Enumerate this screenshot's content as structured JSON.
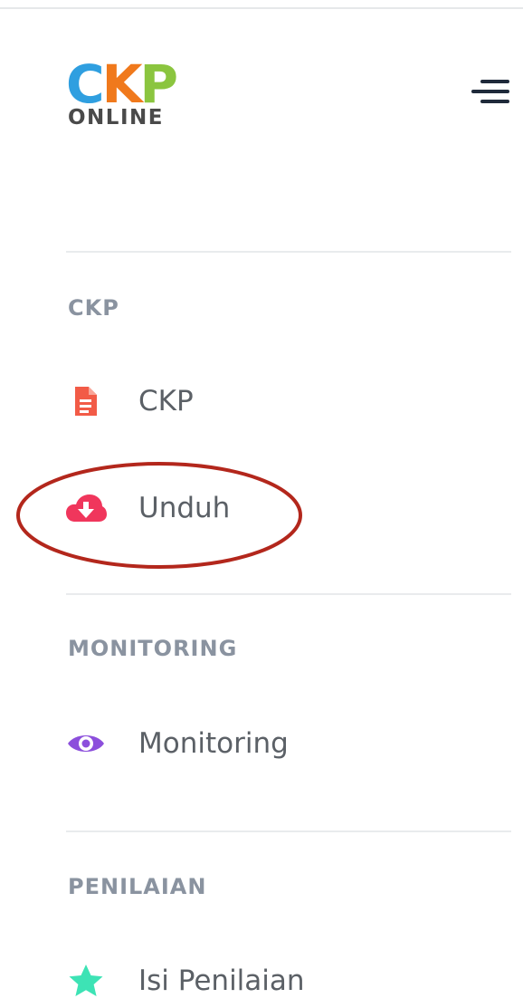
{
  "logo": {
    "letters": [
      "C",
      "K",
      "P"
    ],
    "subtitle": "ONLINE",
    "colors": {
      "c": "#2f9fe0",
      "k": "#f0791c",
      "p": "#8bc53f"
    }
  },
  "menu_toggle_icon": "hamburger-icon",
  "sections": [
    {
      "title": "CKP",
      "items": [
        {
          "label": "CKP",
          "icon": "file-icon",
          "icon_color": "#f25b47"
        },
        {
          "label": "Unduh",
          "icon": "cloud-download-icon",
          "icon_color": "#f0365c"
        }
      ]
    },
    {
      "title": "MONITORING",
      "items": [
        {
          "label": "Monitoring",
          "icon": "eye-icon",
          "icon_color": "#8c4fdc"
        }
      ]
    },
    {
      "title": "PENILAIAN",
      "items": [
        {
          "label": "Isi Penilaian",
          "icon": "star-icon",
          "icon_color": "#3de3b5"
        }
      ]
    }
  ],
  "annotation": {
    "shape": "ellipse",
    "color": "#b3271c",
    "target": "Unduh"
  }
}
